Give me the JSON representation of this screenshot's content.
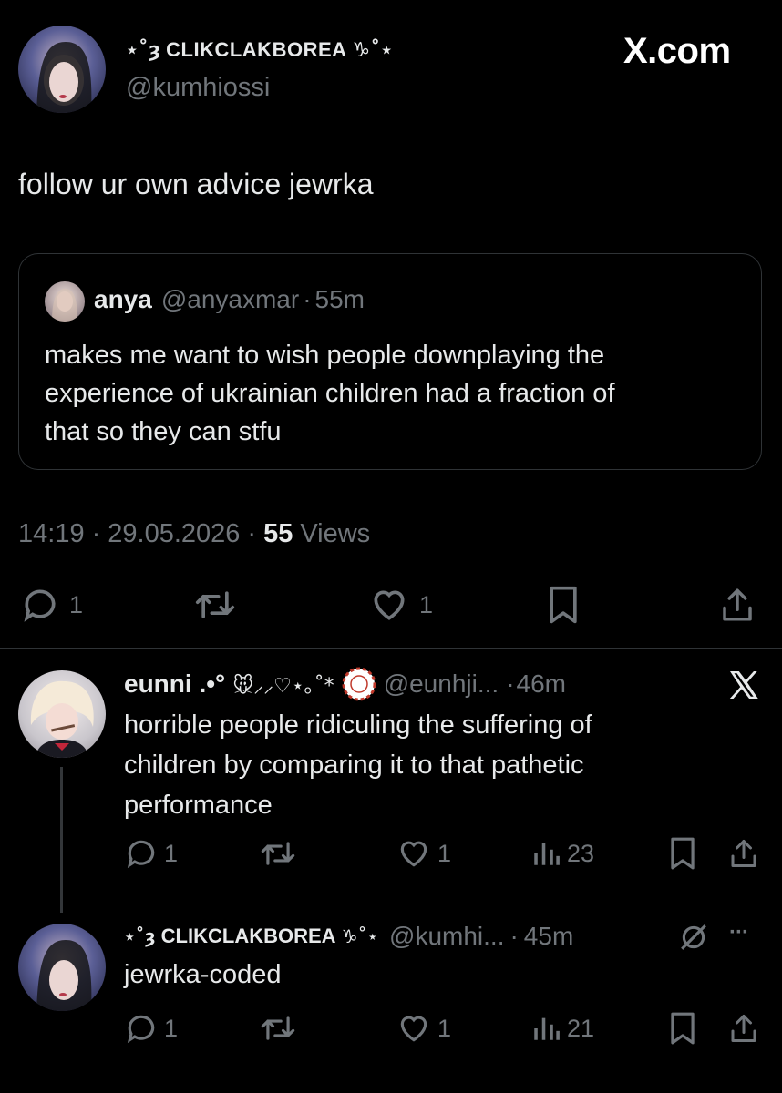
{
  "main_tweet": {
    "display_name": "CLIKCLAKBOREA",
    "name_prefix": "⋆˚ȝ",
    "name_suffix": "♑˚⋆",
    "handle": "@kumhiossi",
    "brand": "X.com",
    "text": "follow ur own advice jewrka",
    "quoted": {
      "name": "anya",
      "handle": "@anyaxmar",
      "sep": "·",
      "time": "55m",
      "text_lines": [
        "makes me want to wish people downplaying the",
        "experience of ukrainian children had a fraction of",
        "that so they can stfu"
      ]
    },
    "meta": {
      "time": "14:19",
      "sep1": "·",
      "date": "29.05.2026",
      "sep2": "·",
      "views_count": "55",
      "views_label": "Views"
    },
    "actions": {
      "replies": "1",
      "likes": "1"
    }
  },
  "reply1": {
    "name": "eunni .•°",
    "name_emojis": "🐭⸝⸝♡⋆｡˚*",
    "handle": "@eunhji...",
    "sep": "·",
    "time": "46m",
    "text_lines": [
      "horrible people ridiculing the suffering of",
      "children by comparing it to that pathetic",
      "performance"
    ],
    "actions": {
      "replies": "1",
      "likes": "1",
      "views": "23"
    }
  },
  "reply2": {
    "name": "CLIKCLAKBOREA",
    "name_prefix": "⋆˚ȝ",
    "name_suffix": "♑˚⋆",
    "handle": "@kumhi...",
    "sep": "·",
    "time": "45m",
    "text": "jewrka-coded",
    "more": "···",
    "actions": {
      "replies": "1",
      "likes": "1",
      "views": "21"
    }
  },
  "colors": {
    "background": "#000000",
    "text": "#e7e9ea",
    "secondary": "#71767b",
    "border": "#2f3336"
  },
  "icons": [
    "reply-icon",
    "retweet-icon",
    "like-icon",
    "bookmark-icon",
    "share-icon",
    "views-icon",
    "x-logo-icon",
    "no-edit-icon",
    "more-icon"
  ]
}
